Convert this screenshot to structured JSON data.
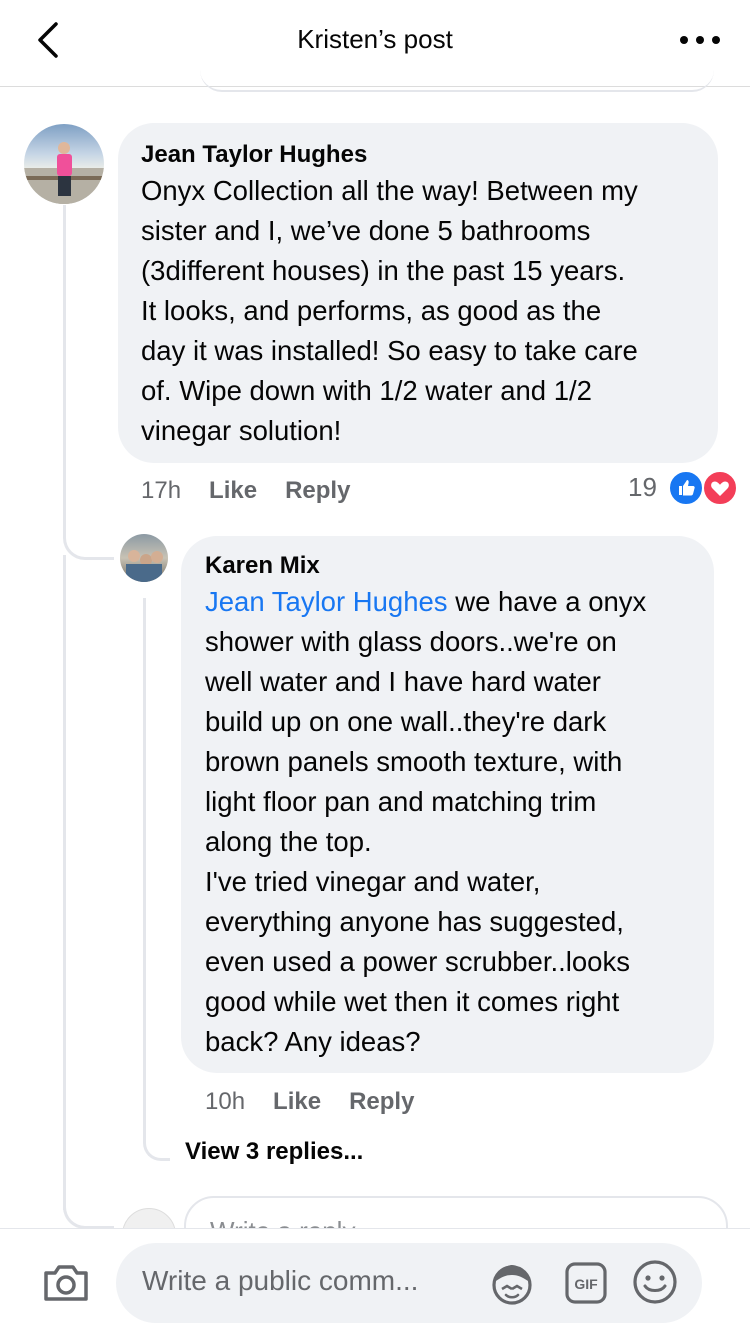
{
  "header": {
    "title": "Kristen’s post"
  },
  "comments": [
    {
      "author": "Jean Taylor Hughes",
      "text": "Onyx Collection all the way! Between my\nsister and I, we’ve done 5 bathrooms\n(3different houses) in the past 15 years.\nIt looks, and performs, as good as the\nday it was installed! So easy to take care\nof. Wipe down with 1/2 water and 1/2\nvinegar solution!",
      "time": "17h",
      "like_label": "Like",
      "reply_label": "Reply",
      "reaction_count": "19",
      "reactions": [
        "like-icon",
        "love-icon"
      ]
    },
    {
      "author": "Karen Mix",
      "mention": "Jean Taylor Hughes",
      "text_first_line": " we have a onyx",
      "text": "shower with glass doors..we're on\nwell water and I have hard water\nbuild up on one wall..they're dark\nbrown panels smooth texture, with\nlight floor pan and matching trim\nalong the top.\nI've tried vinegar and water,\neverything anyone has suggested,\neven used a power scrubber..looks\ngood while wet then it comes right\nback? Any ideas?",
      "time": "10h",
      "like_label": "Like",
      "reply_label": "Reply"
    }
  ],
  "view_replies": "View 3 replies...",
  "reply_box": {
    "placeholder": "Write a reply..."
  },
  "bottom_bar": {
    "placeholder": "Write a public comm...",
    "gif_label": "GIF"
  },
  "colors": {
    "bubble": "#f0f2f5",
    "mention": "#1877f2",
    "like": "#1877f2",
    "love": "#f33e58",
    "meta": "#65676b"
  }
}
